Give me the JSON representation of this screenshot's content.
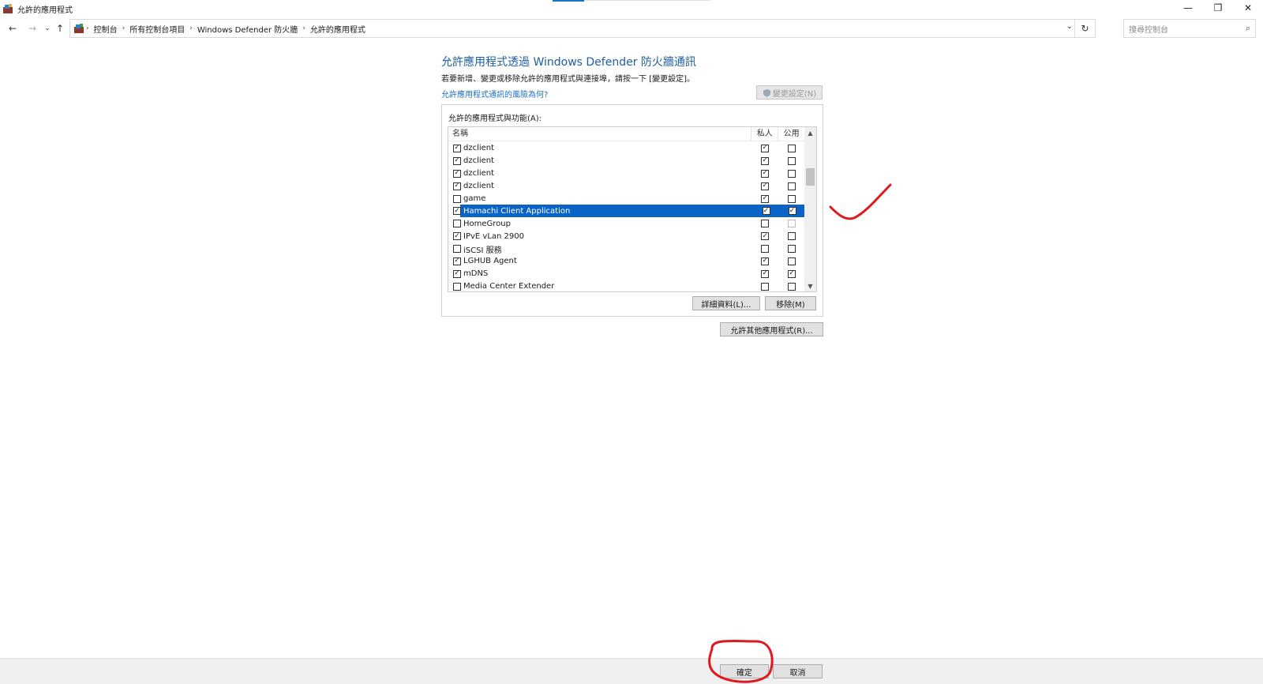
{
  "window": {
    "title": "允許的應用程式"
  },
  "address": {
    "breadcrumbs": [
      "控制台",
      "所有控制台項目",
      "Windows Defender 防火牆",
      "允許的應用程式"
    ],
    "search_placeholder": "搜尋控制台"
  },
  "main": {
    "heading": "允許應用程式透過 Windows Defender 防火牆通訊",
    "subtext": "若要新增、變更或移除允許的應用程式與連接埠，請按一下 [變更設定]。",
    "risk_link": "允許應用程式通訊的風險為何?",
    "change_settings_label": "變更設定(N)",
    "group_label": "允許的應用程式與功能(A):",
    "columns": {
      "name": "名稱",
      "private": "私人",
      "public": "公用"
    },
    "rows": [
      {
        "name": "dzclient",
        "enabled": true,
        "private": true,
        "public": false
      },
      {
        "name": "dzclient",
        "enabled": true,
        "private": true,
        "public": false
      },
      {
        "name": "dzclient",
        "enabled": true,
        "private": true,
        "public": false
      },
      {
        "name": "dzclient",
        "enabled": true,
        "private": true,
        "public": false
      },
      {
        "name": "game",
        "enabled": false,
        "private": true,
        "public": false
      },
      {
        "name": "Hamachi Client Application",
        "enabled": true,
        "private": true,
        "public": true,
        "selected": true
      },
      {
        "name": "HomeGroup",
        "enabled": false,
        "private": false,
        "public": false
      },
      {
        "name": "IPvE vLan 2900",
        "enabled": true,
        "private": true,
        "public": false
      },
      {
        "name": "iSCSI 服務",
        "enabled": false,
        "private": false,
        "public": false
      },
      {
        "name": "LGHUB Agent",
        "enabled": true,
        "private": true,
        "public": false
      },
      {
        "name": "mDNS",
        "enabled": true,
        "private": true,
        "public": true
      },
      {
        "name": "Media Center Extender",
        "enabled": false,
        "private": false,
        "public": false
      }
    ],
    "details_label": "詳細資料(L)...",
    "remove_label": "移除(M)",
    "allow_other_label": "允許其他應用程式(R)..."
  },
  "footer": {
    "ok_label": "確定",
    "cancel_label": "取消"
  },
  "colors": {
    "heading": "#1e5fa8",
    "selection": "#0a64c8",
    "annotation": "#e0191f"
  }
}
